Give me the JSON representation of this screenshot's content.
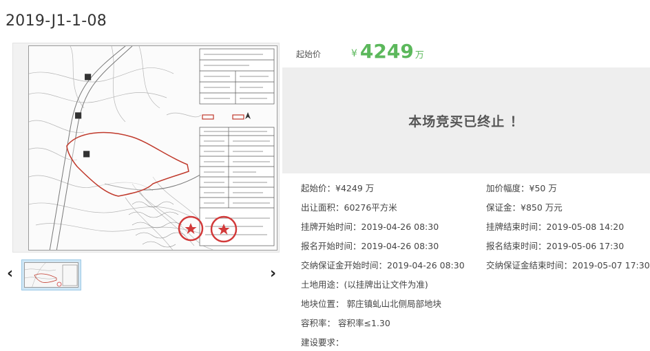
{
  "title": "2019-J1-1-08",
  "price_header": {
    "label": "起始价",
    "yen": "¥",
    "amount": "4249",
    "unit": "万"
  },
  "banner": {
    "message": "本场竞买已终止 ！"
  },
  "thumbnails": {
    "prev_icon": "chevron-left-icon",
    "next_icon": "chevron-right-icon",
    "prev_glyph": "‹",
    "next_glyph": "›"
  },
  "details": {
    "start_price": {
      "label": "起始价：",
      "value": "¥4249 万"
    },
    "increment": {
      "label": "加价幅度：",
      "value": "¥50 万"
    },
    "area": {
      "label": "出让面积：",
      "value": "60276平方米"
    },
    "deposit": {
      "label": "保证金：",
      "value": "¥850 万元"
    },
    "listing_start": {
      "label": "挂牌开始时间：",
      "value": "2019-04-26 08:30"
    },
    "listing_end": {
      "label": "挂牌结束时间：",
      "value": "2019-05-08 14:20"
    },
    "signup_start": {
      "label": "报名开始时间：",
      "value": "2019-04-26 08:30"
    },
    "signup_end": {
      "label": "报名结束时间：",
      "value": "2019-05-06 17:30"
    },
    "deposit_start": {
      "label": "交纳保证金开始时间：",
      "value": "2019-04-26 08:30"
    },
    "deposit_end": {
      "label": "交纳保证金结束时间：",
      "value": "2019-05-07 17:30"
    },
    "land_use": {
      "label": "土地用途：",
      "value": "(以挂牌出让文件为准)"
    },
    "location": {
      "label": "地块位置：",
      "value": "郭庄镇虬山北侧局部地块"
    },
    "plot_ratio": {
      "label": "容积率：",
      "value": "容积率≤1.30"
    },
    "build_req": {
      "label": "建设要求：",
      "value": ""
    }
  },
  "colors": {
    "price_green": "#5cb85c",
    "banner_bg": "#eeeeee",
    "thumb_active": "#cfe6f5"
  }
}
